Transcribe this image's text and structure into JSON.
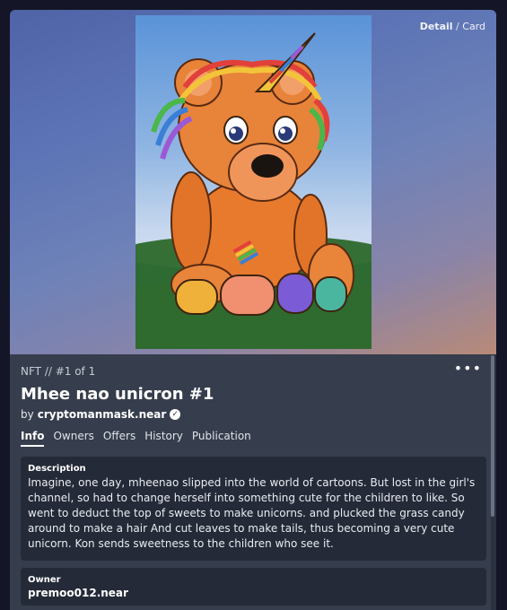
{
  "breadcrumb": {
    "current": "Detail",
    "separator": "/",
    "parent": "Card"
  },
  "nft": {
    "meta": "NFT // #1 of 1",
    "title": "Mhee nao unicron #1",
    "by_prefix": "by",
    "creator": "cryptomanmask.near"
  },
  "tabs": [
    "Info",
    "Owners",
    "Offers",
    "History",
    "Publication"
  ],
  "active_tab": "Info",
  "description": {
    "label": "Description",
    "text": "Imagine, one day, mheenao slipped into the world of cartoons. But lost in the girl's channel, so had to change herself into something cute for the children to like. So went to deduct the top of sweets to make unicorns. and plucked the grass candy around to make a hair And cut leaves to make tails, thus becoming a very cute unicorn. Kon sends sweetness to the children who see it."
  },
  "owner": {
    "label": "Owner",
    "value": "premoo012.near"
  },
  "icons": {
    "more": "more-dots-icon",
    "verified": "verified-badge-icon"
  },
  "colors": {
    "accent": "#ffffff",
    "panel": "#242a37",
    "surface": "#363d4c"
  }
}
